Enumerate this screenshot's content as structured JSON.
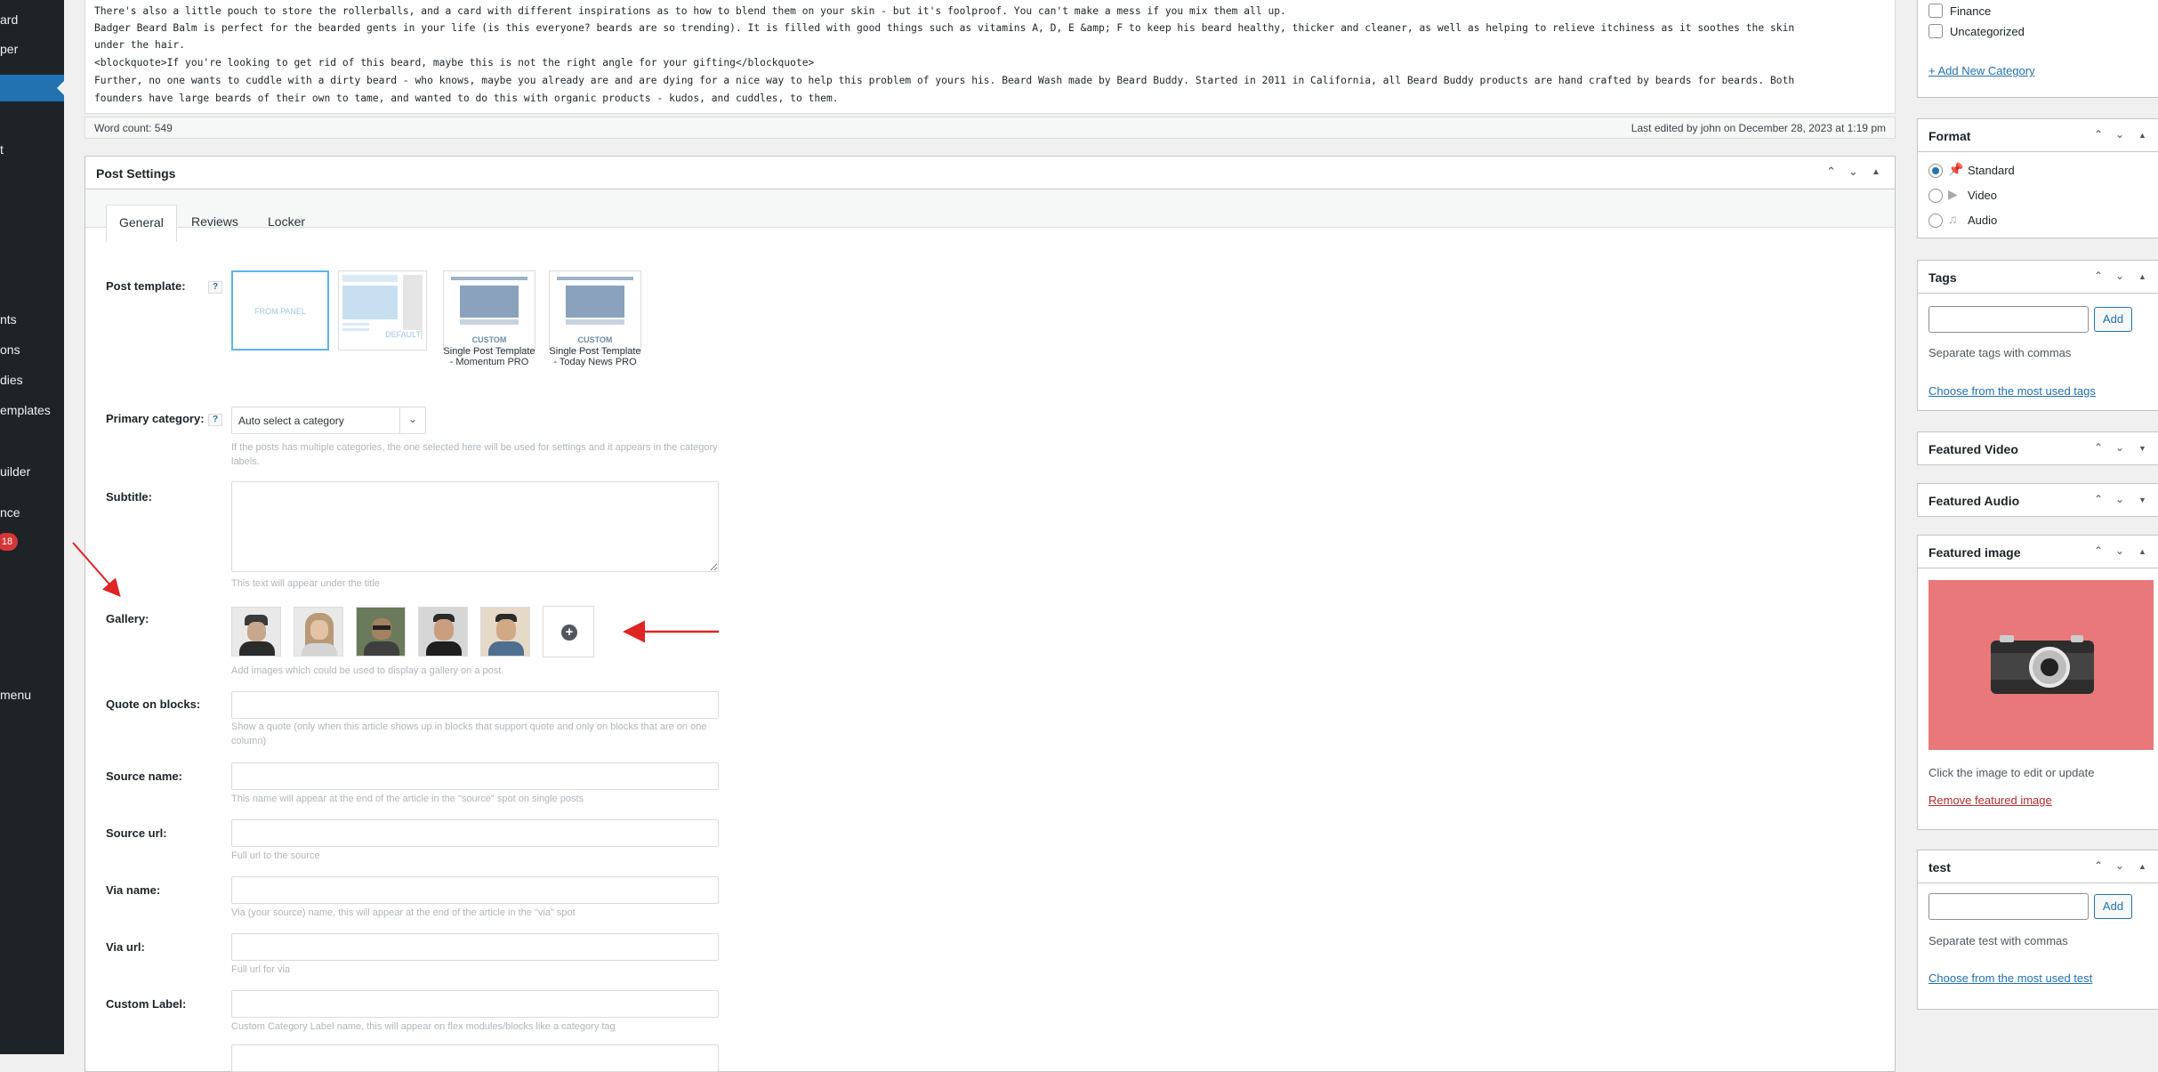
{
  "admin_menu": {
    "items": [
      "ard",
      "per",
      "t",
      "nts",
      "ons",
      "dies",
      "emplates",
      "uilder",
      "nce",
      "menu"
    ],
    "badge": "18"
  },
  "editor": {
    "lines": [
      "There's also a little pouch to store the rollerballs, and a card with different inspirations as to how to blend them on your skin - but it's foolproof. You can't make a mess if you mix them all up.",
      "Badger Beard Balm is perfect for the bearded gents in your life (is this everyone? beards are so trending). It is filled with good things such as vitamins A, D, E &amp; F to keep his beard healthy, thicker and cleaner, as well as helping to relieve itchiness as it soothes the skin",
      "under the hair.",
      "<blockquote>If you're looking to get rid of this beard, maybe this is not the right angle for your gifting</blockquote>",
      "Further, no one wants to cuddle with a dirty beard - who knows, maybe you already are and are dying for a nice way to help this problem of yours his. Beard Wash made by Beard Buddy. Started in 2011 in California, all Beard Buddy products are hand crafted by beards for beards. Both",
      "founders have large beards of their own to tame, and wanted to do this with organic products - kudos, and cuddles, to them."
    ],
    "word_count": "Word count: 549",
    "last_edited": "Last edited by john on December 28, 2023 at 1:19 pm"
  },
  "post_settings": {
    "title": "Post Settings",
    "tabs": [
      "General",
      "Reviews",
      "Locker"
    ],
    "help_glyph": "?",
    "template": {
      "label": "Post template:",
      "options": [
        {
          "tag": "FROM PANEL",
          "caption": ""
        },
        {
          "tag": "DEFAULT",
          "caption": ""
        },
        {
          "tag": "CUSTOM",
          "caption": "Single Post Template - Momentum PRO"
        },
        {
          "tag": "CUSTOM",
          "caption": "Single Post Template - Today News PRO"
        }
      ]
    },
    "primary_category": {
      "label": "Primary category:",
      "value": "Auto select a category",
      "help": "If the posts has multiple categories, the one selected here will be used for settings and it appears in the category labels."
    },
    "subtitle": {
      "label": "Subtitle:",
      "help": "This text will appear under the title"
    },
    "gallery": {
      "label": "Gallery:",
      "image_count": 5,
      "help": "Add images which could be used to display a gallery on a post."
    },
    "quote": {
      "label": "Quote on blocks:",
      "help": "Show a quote (only when this article shows up in blocks that support quote and only on blocks that are on one column)"
    },
    "source_name": {
      "label": "Source name:",
      "help": "This name will appear at the end of the article in the \"source\" spot on single posts"
    },
    "source_url": {
      "label": "Source url:",
      "help": "Full url to the source"
    },
    "via_name": {
      "label": "Via name:",
      "help": "Via (your source) name, this will appear at the end of the article in the \"via\" spot"
    },
    "via_url": {
      "label": "Via url:",
      "help": "Full url for via"
    },
    "custom_label": {
      "label": "Custom Label:",
      "help": "Custom Category Label name, this will appear on flex modules/blocks like a category tag"
    }
  },
  "sidebar": {
    "categories": {
      "items": [
        "Finance",
        "Uncategorized"
      ],
      "add_link": "+ Add New Category"
    },
    "format": {
      "title": "Format",
      "options": [
        {
          "label": "Standard",
          "icon": "pin-icon",
          "selected": true
        },
        {
          "label": "Video",
          "icon": "video-icon",
          "selected": false
        },
        {
          "label": "Audio",
          "icon": "audio-icon",
          "selected": false
        }
      ]
    },
    "tags": {
      "title": "Tags",
      "add": "Add",
      "hint": "Separate tags with commas",
      "link": "Choose from the most used tags"
    },
    "featured_video": {
      "title": "Featured Video"
    },
    "featured_audio": {
      "title": "Featured Audio"
    },
    "featured_image": {
      "title": "Featured image",
      "hint": "Click the image to edit or update",
      "remove": "Remove featured image"
    },
    "test": {
      "title": "test",
      "add": "Add",
      "hint": "Separate test with commas",
      "link": "Choose from the most used test"
    }
  },
  "colors": {
    "accent": "#2271b1",
    "annotation_arrow": "#e02424",
    "featured_bg": "#e8787a"
  }
}
